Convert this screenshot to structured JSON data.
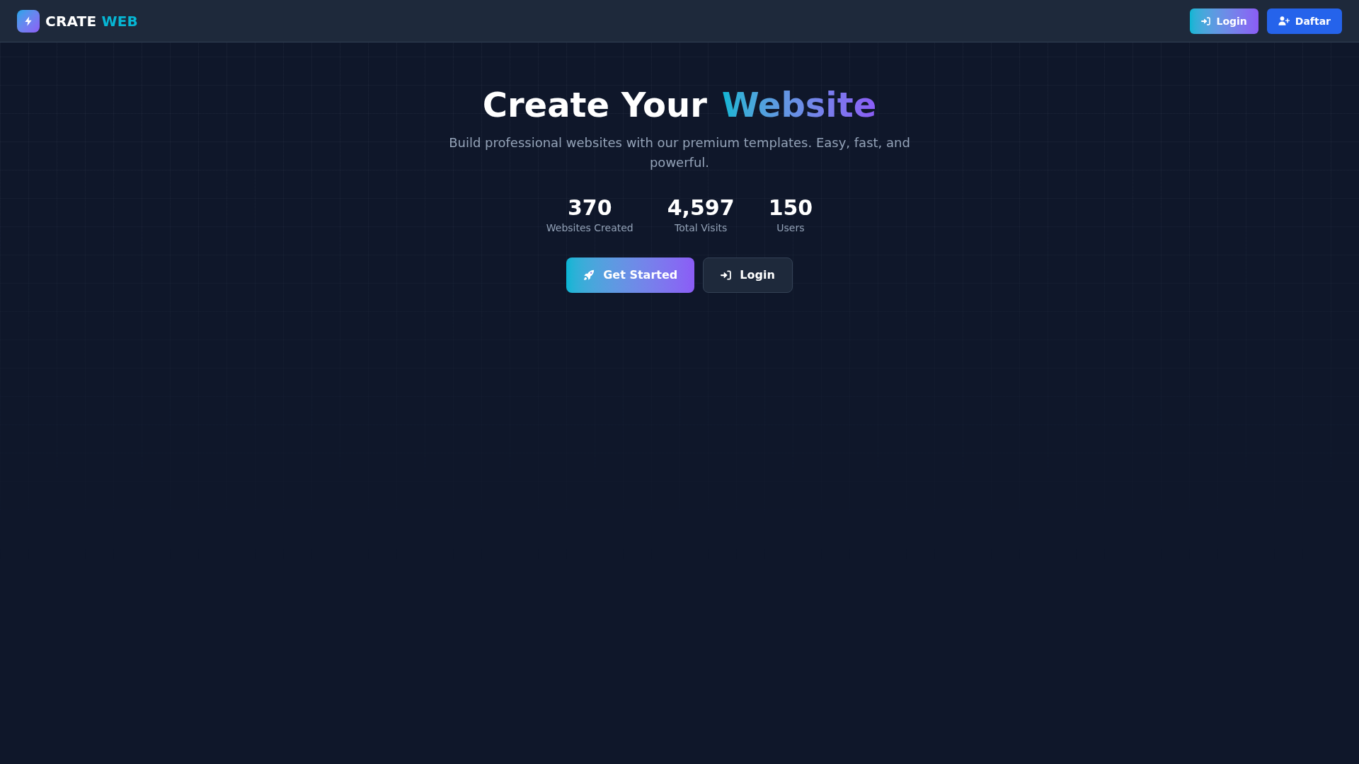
{
  "header": {
    "logo": {
      "text": "CRATE",
      "accent": "WEB"
    },
    "buttons": [
      {
        "label": "Login",
        "kind": "login"
      },
      {
        "label": "Daftar",
        "kind": "register"
      }
    ]
  },
  "hero": {
    "title": {
      "text": "Create Your",
      "highlight": "Website"
    },
    "subtitle": "Build professional websites with our premium templates. Easy, fast, and powerful.",
    "stats": [
      {
        "value": "370",
        "label": "Websites Created"
      },
      {
        "value": "4,597",
        "label": "Total Visits"
      },
      {
        "value": "150",
        "label": "Users"
      }
    ],
    "actions": [
      {
        "label": "Get Started",
        "kind": "start"
      },
      {
        "label": "Login",
        "kind": "login"
      }
    ]
  }
}
